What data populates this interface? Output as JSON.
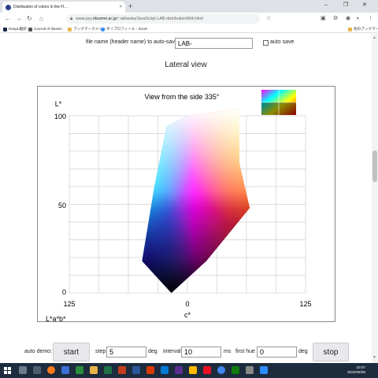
{
  "browser": {
    "tab_title": "Distribution of colors in the H…",
    "tab_close": "×",
    "new_tab": "+",
    "url_prefix": "www.psy.",
    "url_host": "ritsumei.ac.jp",
    "url_path": "/~akitaoka/JavaScript-LAB-distribution0tiHi.html",
    "window_controls": [
      "–",
      "❐",
      "✕"
    ],
    "bookmarks": [
      {
        "label": "DeepL翻訳",
        "color": "#1a2b4b"
      },
      {
        "label": "Journal of Illusion",
        "color": "#555555"
      },
      {
        "label": "ブックマークメニュー",
        "color": "#e8b44a"
      },
      {
        "label": "マイプロフィール - Zoom",
        "color": "#2d8cff"
      }
    ],
    "other_bookmarks": "他のブックマーク"
  },
  "form": {
    "file_name_label": "file name (header name) to auto-save",
    "file_name_value": "LAB-",
    "auto_save_label": "auto save",
    "auto_save_checked": false
  },
  "section_title": "Lateral view",
  "chart_data": {
    "type": "area",
    "title": "View from the side 335°",
    "ylabel": "L*",
    "xlabel": "c*",
    "corner_label": "L*a*b*",
    "x_ticks": [
      "125",
      "0",
      "125"
    ],
    "y_ticks": [
      "100",
      "50",
      "0"
    ],
    "xlim": [
      -125,
      125
    ],
    "ylim": [
      0,
      100
    ],
    "grid": true,
    "gamut_outline": [
      {
        "c": -22,
        "L": 94
      },
      {
        "c": 0,
        "L": 100
      },
      {
        "c": 55,
        "L": 104
      },
      {
        "c": 55,
        "L": 73
      },
      {
        "c": 66,
        "L": 48
      },
      {
        "c": 20,
        "L": 18
      },
      {
        "c": -17,
        "L": 0
      },
      {
        "c": -48,
        "L": 18
      },
      {
        "c": -35,
        "L": 60
      }
    ],
    "gamut_colors": {
      "cyan": "#00ffff",
      "white": "#ffffff",
      "yellow": "#ffff00",
      "red": "#ff2a2a",
      "magenta": "#ff00ff",
      "blue": "#3010ff",
      "black": "#000000"
    }
  },
  "controls": {
    "auto_demo_label": "auto demo:",
    "start_label": "start",
    "step_label": "step",
    "step_value": "5",
    "step_unit": "deg",
    "interval_label": "interval",
    "interval_value": "10",
    "interval_unit": "ms",
    "first_hue_label": "first hue",
    "first_hue_value": "0",
    "first_hue_unit": "deg",
    "stop_label": "stop"
  },
  "taskbar": {
    "time": "10:07",
    "date": "2022/06/06"
  }
}
